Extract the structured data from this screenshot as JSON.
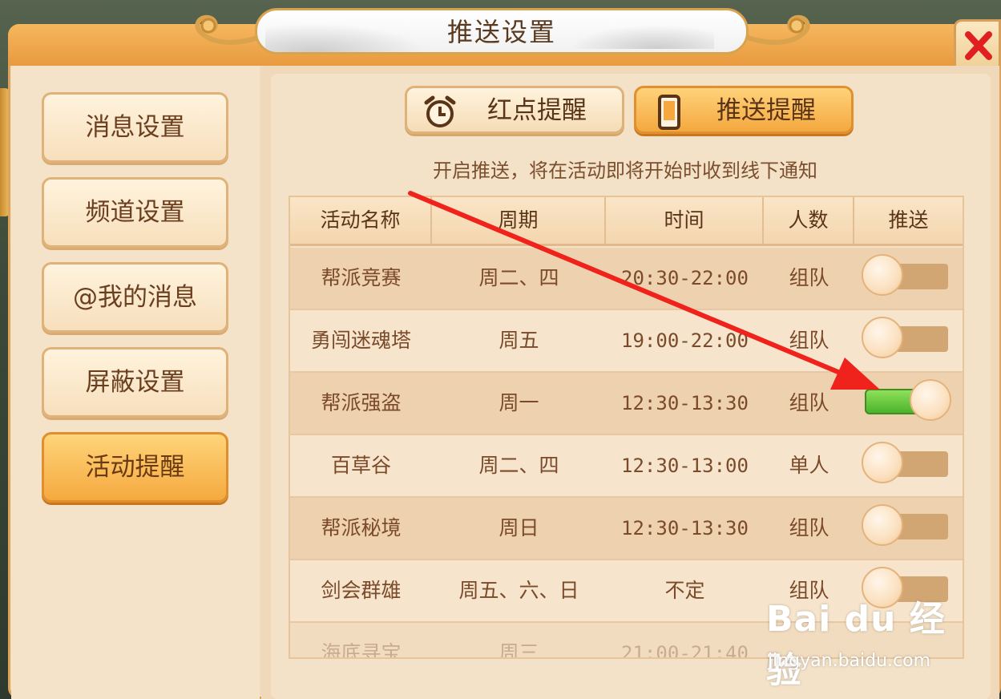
{
  "window": {
    "title": "推送设置"
  },
  "sidebar": {
    "items": [
      {
        "label": "消息设置",
        "active": false
      },
      {
        "label": "频道设置",
        "active": false
      },
      {
        "label": "@我的消息",
        "active": false
      },
      {
        "label": "屏蔽设置",
        "active": false
      },
      {
        "label": "活动提醒",
        "active": true
      }
    ]
  },
  "tabs": [
    {
      "label": "红点提醒",
      "icon": "alarm-clock-icon",
      "active": false
    },
    {
      "label": "推送提醒",
      "icon": "phone-icon",
      "active": true
    }
  ],
  "hint": "开启推送，将在活动即将开始时收到线下通知",
  "table": {
    "headers": [
      "活动名称",
      "周期",
      "时间",
      "人数",
      "推送"
    ],
    "rows": [
      {
        "name": "帮派竞赛",
        "period": "周二、四",
        "time": "20:30-22:00",
        "people": "组队",
        "push": false
      },
      {
        "name": "勇闯迷魂塔",
        "period": "周五",
        "time": "19:00-22:00",
        "people": "组队",
        "push": false
      },
      {
        "name": "帮派强盗",
        "period": "周一",
        "time": "12:30-13:30",
        "people": "组队",
        "push": true
      },
      {
        "name": "百草谷",
        "period": "周二、四",
        "time": "12:30-13:00",
        "people": "单人",
        "push": false
      },
      {
        "name": "帮派秘境",
        "period": "周日",
        "time": "12:30-13:30",
        "people": "组队",
        "push": false
      },
      {
        "name": "剑会群雄",
        "period": "周五、六、日",
        "time": "不定",
        "people": "组队",
        "push": false
      },
      {
        "name": "海底寻宝",
        "period": "周三",
        "time": "21:00-21:40",
        "people": "",
        "push": false
      }
    ]
  },
  "watermark": {
    "logo": "Bai du 经验",
    "url": "jingyan.baidu.com"
  },
  "colors": {
    "accent": "#f4a83f",
    "toggle_on": "#4cb32c",
    "arrow": "#f0221c",
    "close": "#e02020"
  }
}
